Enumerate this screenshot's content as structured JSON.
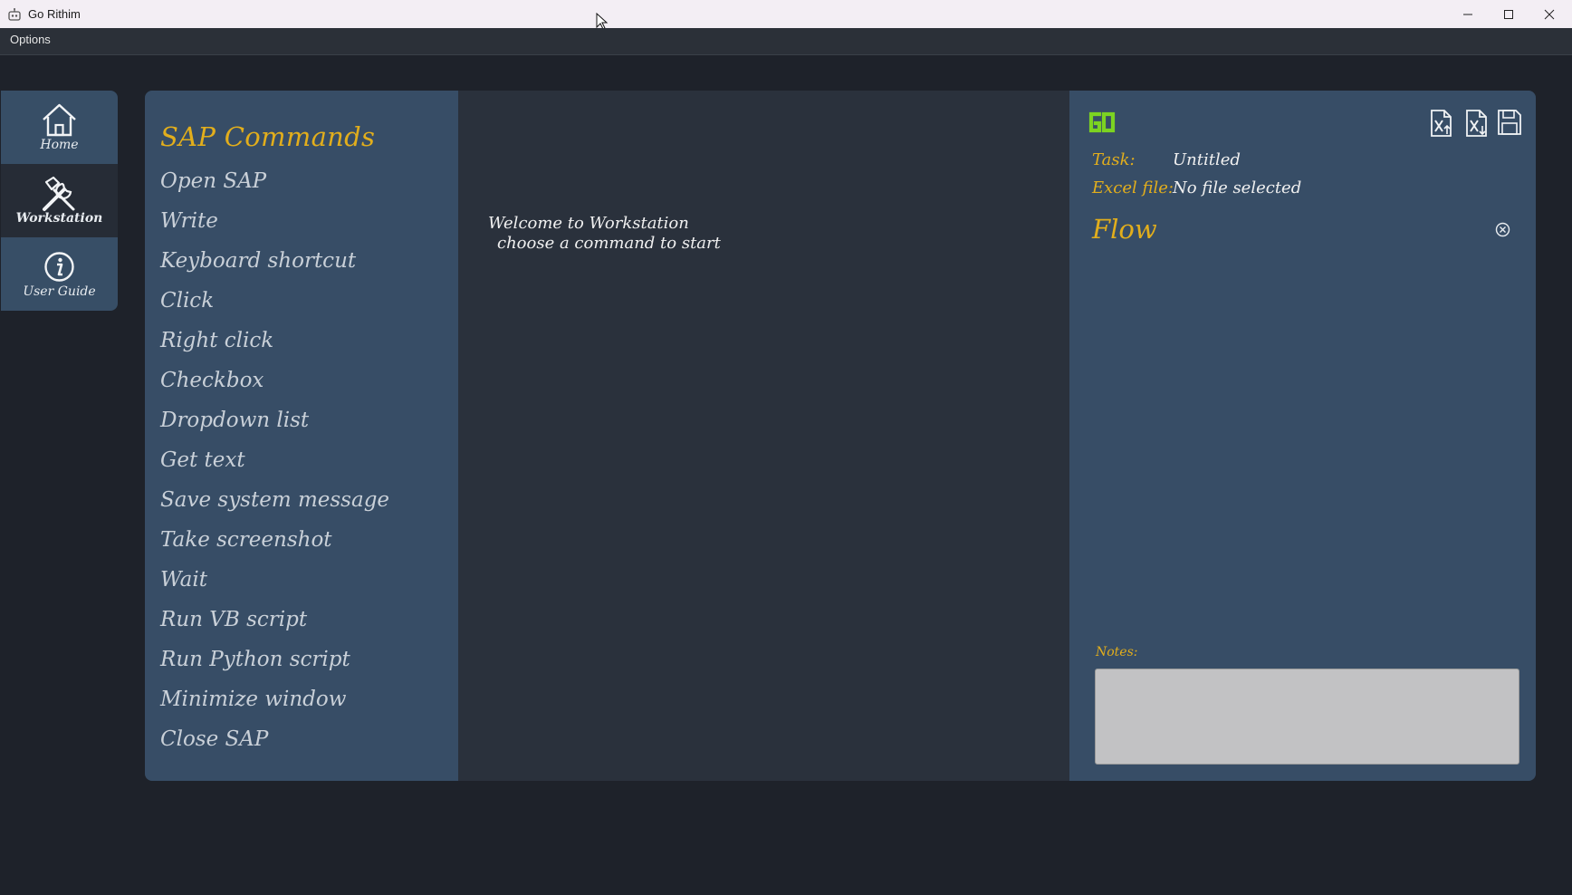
{
  "window": {
    "title": "Go Rithim",
    "controls": [
      "minimize-icon",
      "maximize-icon",
      "close-icon"
    ]
  },
  "menu": {
    "options_label": "Options"
  },
  "nav": {
    "items": [
      {
        "label": "Home",
        "icon": "home-icon",
        "active": false
      },
      {
        "label": "Workstation",
        "icon": "tools-icon",
        "active": true
      },
      {
        "label": "User Guide",
        "icon": "info-icon",
        "active": false
      }
    ]
  },
  "commands": {
    "title": "SAP Commands",
    "items": [
      "Open SAP",
      "Write",
      "Keyboard shortcut",
      "Click",
      "Right click",
      "Checkbox",
      "Dropdown list",
      "Get text",
      "Save system message",
      "Take screenshot",
      "Wait",
      "Run VB script",
      "Run Python script",
      "Minimize window",
      "Close SAP"
    ]
  },
  "workspace": {
    "welcome_line1": "Welcome to Workstation",
    "welcome_line2": "choose a command to start"
  },
  "flow_panel": {
    "logo": "GO",
    "toolbar_icons": [
      "excel-import-icon",
      "excel-export-icon",
      "save-icon"
    ],
    "task_label": "Task:",
    "task_value": "Untitled",
    "excel_label": "Excel file:",
    "excel_value": "No file selected",
    "flow_title": "Flow",
    "notes_label": "Notes:",
    "notes_value": ""
  },
  "colors": {
    "accent": "#e2ae1c",
    "go_green": "#7cd321",
    "panel": "#374d66",
    "background": "#1e222a"
  }
}
